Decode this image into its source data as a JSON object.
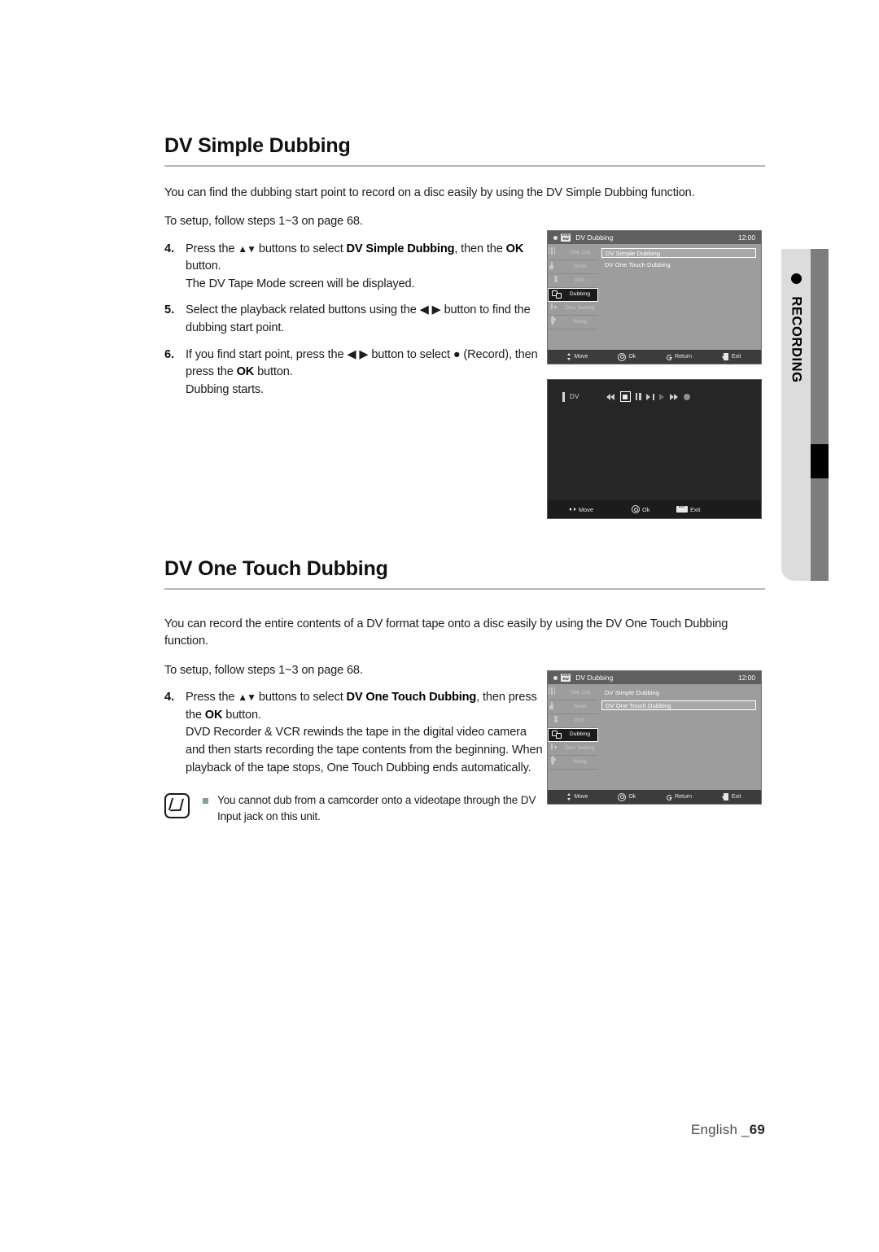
{
  "section1": {
    "title": "DV Simple Dubbing",
    "intro": "You can find the dubbing start point to record on a disc easily by using the DV Simple Dubbing function.",
    "setup_note": "To setup, follow steps 1~3 on page 68.",
    "steps": [
      {
        "num": "4.",
        "text_a": "Press the ",
        "arrows": "▲▼",
        "text_b": " buttons to select ",
        "bold_a": "DV Simple Dubbing",
        "text_c": ", then the ",
        "bold_b": "OK",
        "text_d": " button.",
        "sub": "The DV Tape Mode screen will be displayed."
      },
      {
        "num": "5.",
        "text_a": "Select the playback related buttons using the ",
        "arrows": "◀ ▶",
        "text_b": " button to find the dubbing start point."
      },
      {
        "num": "6.",
        "text_a": "If you find start point, press the ",
        "arrows": "◀ ▶",
        "text_b": " button to select ",
        "record_symbol": "●",
        "text_c": " (Record), then press the ",
        "bold_b": "OK",
        "text_d": " button.",
        "sub": "Dubbing starts."
      }
    ]
  },
  "section2": {
    "title": "DV One Touch Dubbing",
    "intro": "You can record the entire contents of a DV format tape onto a disc easily by using the DV One Touch Dubbing function.",
    "setup_note": "To setup, follow steps 1~3 on page 68.",
    "steps": [
      {
        "num": "4.",
        "text_a": "Press the ",
        "arrows": "▲▼",
        "text_b": " buttons to select ",
        "bold_a": "DV One Touch Dubbing",
        "text_c": ", then press the ",
        "bold_b": "OK",
        "text_d": " button.",
        "sub": "DVD Recorder & VCR rewinds the tape in the digital video camera and then starts recording the tape contents from the beginning. When playback of the tape stops, One Touch Dubbing ends automatically."
      }
    ]
  },
  "note": {
    "icon": "note-pen-icon",
    "bullet": "square-bullet",
    "text": "You cannot dub from a camcorder onto a videotape through the DV Input jack on this unit."
  },
  "side_tab": {
    "label": "RECORDING",
    "dot": "record-dot-icon"
  },
  "osd1": {
    "disc_badge_line1": "DVD",
    "disc_badge_line2": "RW",
    "title": "DV Dubbing",
    "clock": "12:00",
    "sidebar": [
      {
        "label": "Title List",
        "icon": "title-list-icon",
        "selected": false
      },
      {
        "label": "Timer",
        "icon": "timer-icon",
        "selected": false
      },
      {
        "label": "Edit",
        "icon": "edit-scissors-icon",
        "selected": false
      },
      {
        "label": "Dubbing",
        "icon": "dubbing-icon",
        "selected": true
      },
      {
        "label": "Disc Setting",
        "icon": "disc-setting-icon",
        "selected": false
      },
      {
        "label": "Setup",
        "icon": "setup-gear-icon",
        "selected": false
      }
    ],
    "menu": [
      {
        "label": "DV Simple Dubbing",
        "selected": true
      },
      {
        "label": "DV One Touch Dubbing",
        "selected": false
      }
    ],
    "footer": [
      {
        "label": "Move",
        "icon": "up-down-arrows-icon"
      },
      {
        "label": "Ok",
        "icon": "ok-button-icon"
      },
      {
        "label": "Return",
        "icon": "return-arrow-icon"
      },
      {
        "label": "Exit",
        "icon": "exit-icon"
      }
    ]
  },
  "osd2": {
    "disc_badge_line1": "DVD",
    "disc_badge_line2": "RW",
    "title": "DV Dubbing",
    "clock": "12:00",
    "sidebar": [
      {
        "label": "Title List",
        "icon": "title-list-icon",
        "selected": false
      },
      {
        "label": "Timer",
        "icon": "timer-icon",
        "selected": false
      },
      {
        "label": "Edit",
        "icon": "edit-scissors-icon",
        "selected": false
      },
      {
        "label": "Dubbing",
        "icon": "dubbing-icon",
        "selected": true
      },
      {
        "label": "Disc Setting",
        "icon": "disc-setting-icon",
        "selected": false
      },
      {
        "label": "Setup",
        "icon": "setup-gear-icon",
        "selected": false
      }
    ],
    "menu": [
      {
        "label": "DV Simple Dubbing",
        "selected": false
      },
      {
        "label": "DV One Touch Dubbing",
        "selected": true
      }
    ],
    "footer": [
      {
        "label": "Move",
        "icon": "up-down-arrows-icon"
      },
      {
        "label": "Ok",
        "icon": "ok-button-icon"
      },
      {
        "label": "Return",
        "icon": "return-arrow-icon"
      },
      {
        "label": "Exit",
        "icon": "exit-icon"
      }
    ]
  },
  "tape_screen": {
    "source_label": "DV",
    "transport": [
      {
        "name": "rewind-icon",
        "selected": false
      },
      {
        "name": "stop-icon",
        "selected": true
      },
      {
        "name": "pause-icon",
        "selected": false
      },
      {
        "name": "slow-advance-icon",
        "selected": false
      },
      {
        "name": "play-icon",
        "selected": false
      },
      {
        "name": "fast-forward-icon",
        "selected": false
      },
      {
        "name": "record-icon",
        "selected": false
      }
    ],
    "footer": [
      {
        "label": "Move",
        "icon": "left-right-arrows-icon"
      },
      {
        "label": "Ok",
        "icon": "ok-button-icon"
      },
      {
        "label": "Exit",
        "icon": "exit-badge-icon"
      }
    ]
  },
  "page_footer": {
    "language": "English _",
    "page_number": "69"
  }
}
